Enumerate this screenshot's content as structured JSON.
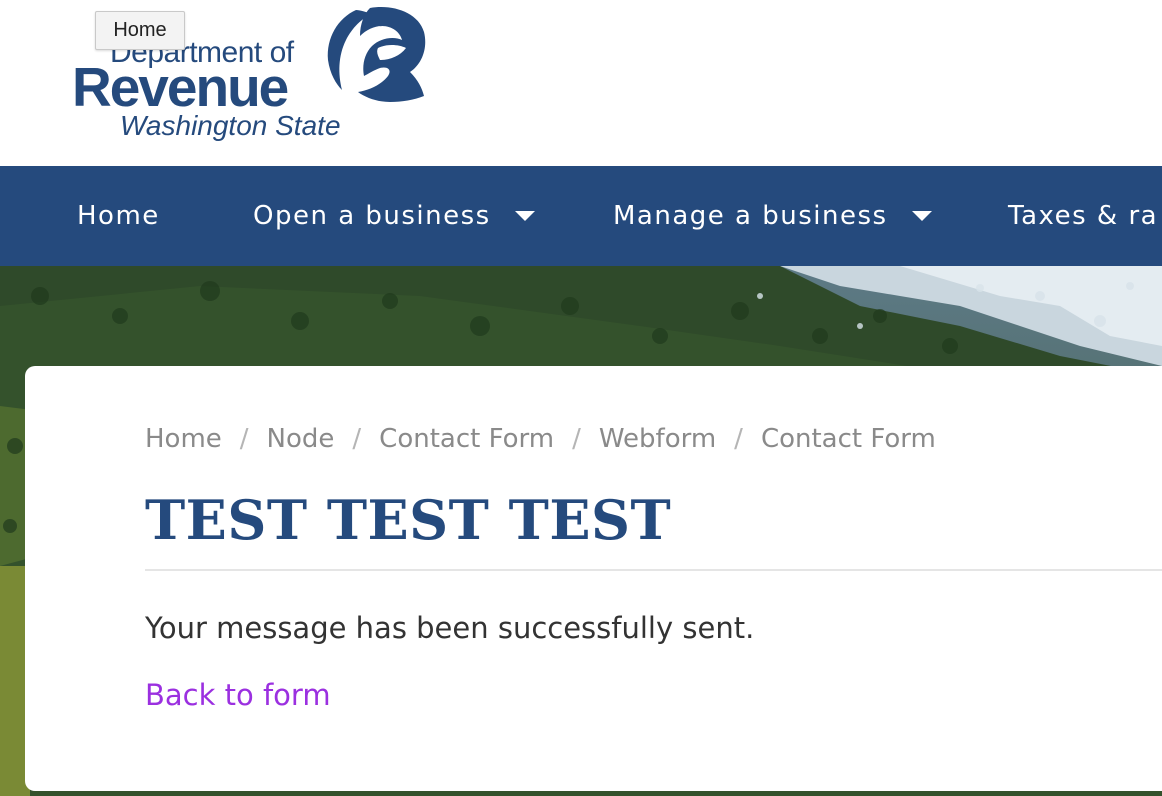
{
  "header": {
    "logo": {
      "line1": "Department of",
      "line2": "Revenue",
      "line3": "Washington State",
      "icon": "dor-swoosh-logo"
    },
    "tooltip": "Home"
  },
  "nav": {
    "items": [
      {
        "label": "Home",
        "has_dropdown": false
      },
      {
        "label": "Open a business",
        "has_dropdown": true
      },
      {
        "label": "Manage a business",
        "has_dropdown": true
      },
      {
        "label": "Taxes & ra",
        "has_dropdown": false
      }
    ]
  },
  "breadcrumb": {
    "items": [
      "Home",
      "Node",
      "Contact Form",
      "Webform",
      "Contact Form"
    ],
    "separator": "/"
  },
  "main": {
    "title": "TEST TEST TEST",
    "message": "Your message has been successfully sent.",
    "back_link": "Back to form"
  },
  "colors": {
    "brand_blue": "#254a7d",
    "link_purple": "#9b30e0",
    "breadcrumb_gray": "#8a8a8a"
  }
}
